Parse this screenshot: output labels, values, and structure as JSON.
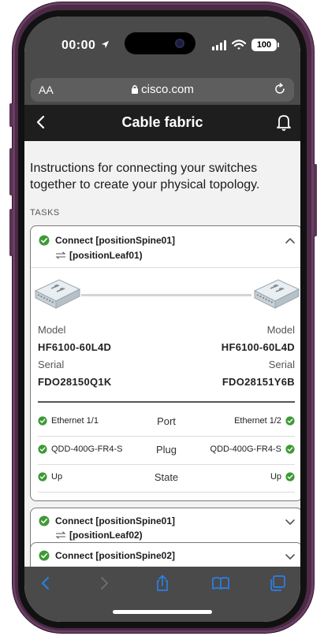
{
  "status_bar": {
    "time": "00:00",
    "battery": "100"
  },
  "browser": {
    "text_size": "AA",
    "domain": "cisco.com"
  },
  "header": {
    "title": "Cable fabric"
  },
  "intro": "Instructions for connecting your switches together to create your physical topology.",
  "section_label": "TASKS",
  "main_task": {
    "title": "Connect [positionSpine01]",
    "subtitle": "[positionLeaf01)",
    "left": {
      "model_label": "Model",
      "model": "HF6100-60L4D",
      "serial_label": "Serial",
      "serial": "FDO28150Q1K"
    },
    "right": {
      "model_label": "Model",
      "model": "HF6100-60L4D",
      "serial_label": "Serial",
      "serial": "FDO28151Y6B"
    },
    "rows": [
      {
        "left": "Ethernet 1/1",
        "label": "Port",
        "right": "Ethernet 1/2"
      },
      {
        "left": "QDD-400G-FR4-S",
        "label": "Plug",
        "right": "QDD-400G-FR4-S"
      },
      {
        "left": "Up",
        "label": "State",
        "right": "Up"
      }
    ]
  },
  "task2": {
    "title": "Connect [positionSpine01]",
    "subtitle": "[positionLeaf02)"
  },
  "task3": {
    "title": "Connect [positionSpine02]"
  },
  "colors": {
    "success": "#3d9a35",
    "header_bg": "#1e1e1e",
    "chrome_bg": "#4a4a4a",
    "toolbar_icon": "#2b7fe8"
  },
  "icons": [
    "location-arrow-icon",
    "signal-icon",
    "wifi-icon",
    "lock-icon",
    "reload-icon",
    "back-icon",
    "bell-icon",
    "check-circle-icon",
    "swap-icon",
    "chevron-up-icon",
    "chevron-down-icon",
    "switch-icon",
    "share-icon",
    "bookmarks-icon",
    "tabs-icon"
  ]
}
